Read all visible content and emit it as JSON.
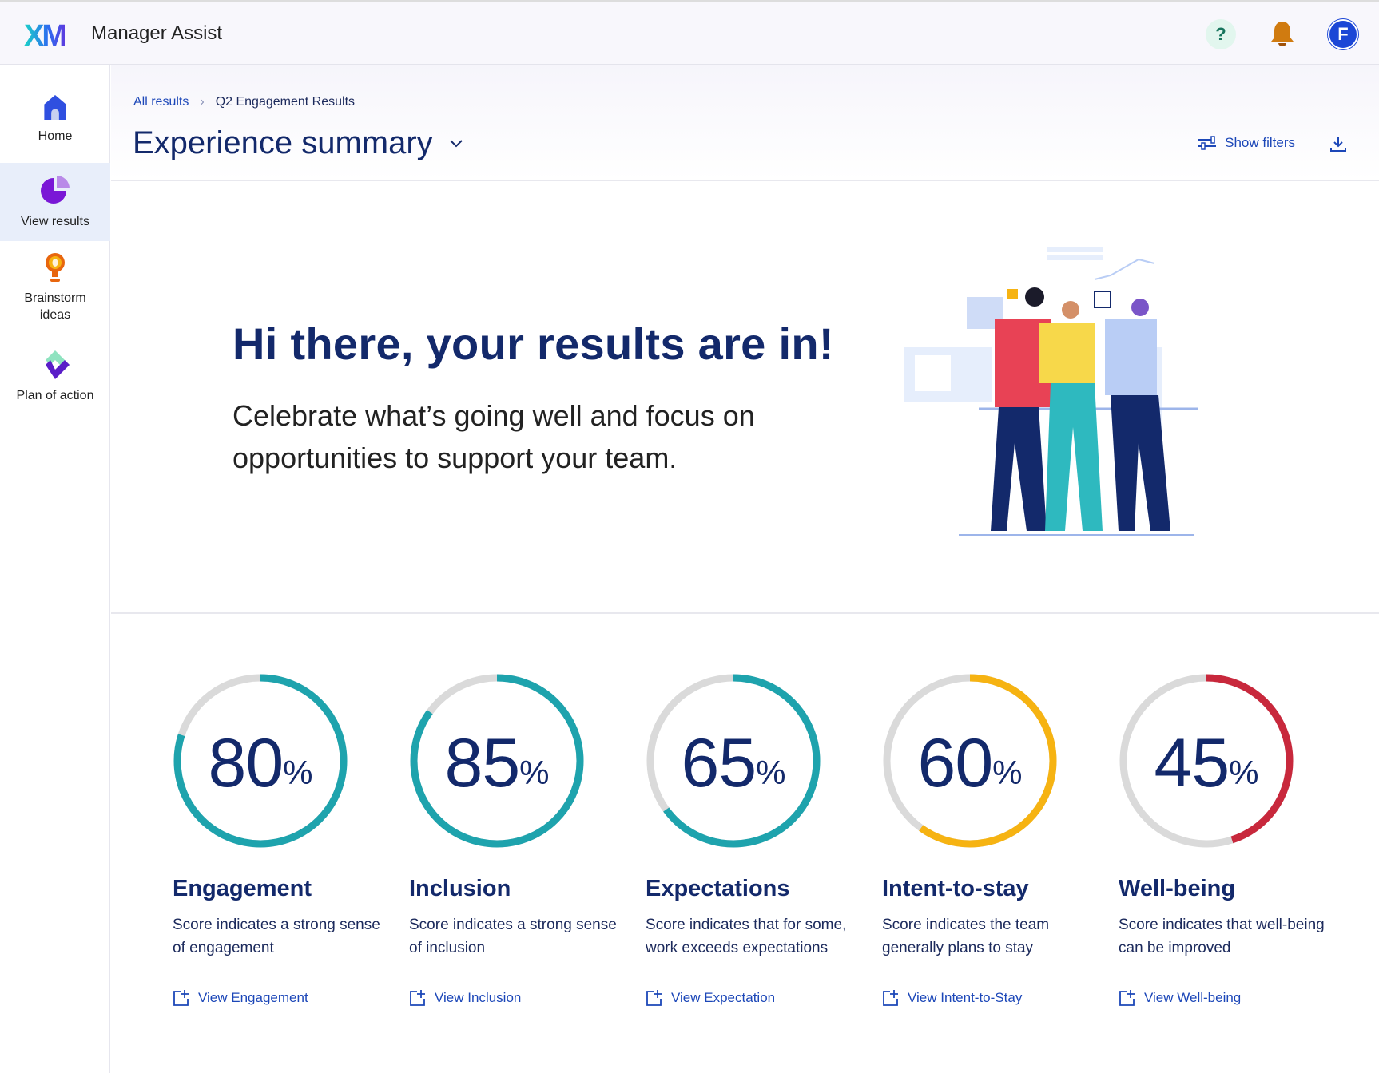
{
  "header": {
    "logo": "XM",
    "app_title": "Manager Assist",
    "help_icon": "question-icon",
    "notifications_icon": "bell-icon",
    "avatar_initial": "F"
  },
  "sidebar": {
    "items": [
      {
        "label": "Home",
        "icon": "home-icon",
        "active": false
      },
      {
        "label": "View results",
        "icon": "pie-chart-icon",
        "active": true
      },
      {
        "label": "Brainstorm ideas",
        "icon": "lightbulb-icon",
        "active": false
      },
      {
        "label": "Plan of action",
        "icon": "diamond-icon",
        "active": false
      }
    ]
  },
  "breadcrumb": {
    "parent": "All results",
    "current": "Q2 Engagement Results"
  },
  "page": {
    "title": "Experience summary",
    "show_filters": "Show filters"
  },
  "hero": {
    "title": "Hi there, your results are in!",
    "subtitle": "Celebrate what’s going well and focus on opportunities to support your team."
  },
  "metrics": [
    {
      "name": "Engagement",
      "value": 80,
      "color": "#1ea3ad",
      "description": "Score indicates a strong sense of engagement",
      "link": "View Engagement"
    },
    {
      "name": "Inclusion",
      "value": 85,
      "color": "#1ea3ad",
      "description": "Score indicates a strong sense of inclusion",
      "link": "View Inclusion"
    },
    {
      "name": "Expectations",
      "value": 65,
      "color": "#1ea3ad",
      "description": "Score indicates that for some, work exceeds expectations",
      "link": "View Expectation"
    },
    {
      "name": "Intent-to-stay",
      "value": 60,
      "color": "#f6b312",
      "description": "Score indicates the team generally plans to stay",
      "link": "View Intent-to-Stay"
    },
    {
      "name": "Well-being",
      "value": 45,
      "color": "#c8283c",
      "description": "Score indicates that well-being can be improved",
      "link": "View Well-being"
    }
  ],
  "percent_sign": "%"
}
